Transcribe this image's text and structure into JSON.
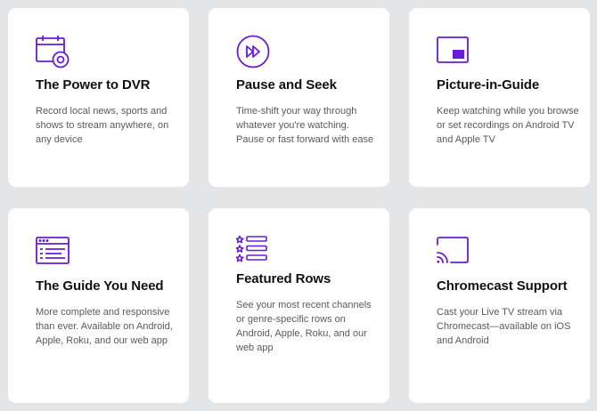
{
  "accent_color": "#6a1bd8",
  "features": [
    {
      "icon": "calendar-record-icon",
      "title": "The Power to DVR",
      "description": "Record local news, sports and shows to stream anywhere, on any device"
    },
    {
      "icon": "fast-forward-icon",
      "title": "Pause and Seek",
      "description": "Time-shift your way through whatever you're watching. Pause or fast forward with ease"
    },
    {
      "icon": "picture-in-picture-icon",
      "title": "Picture-in-Guide",
      "description": "Keep watching while you browse or set recordings on Android TV and Apple TV"
    },
    {
      "icon": "guide-window-icon",
      "title": "The Guide You Need",
      "description": "More complete and responsive than ever. Available on Android, Apple, Roku, and our web app"
    },
    {
      "icon": "starred-list-icon",
      "title": "Featured Rows",
      "description": "See your most recent channels or genre-specific rows on Android, Apple, Roku, and our web app"
    },
    {
      "icon": "chromecast-icon",
      "title": "Chromecast Support",
      "description": "Cast your Live TV stream via Chromecast—available on iOS and Android"
    }
  ]
}
